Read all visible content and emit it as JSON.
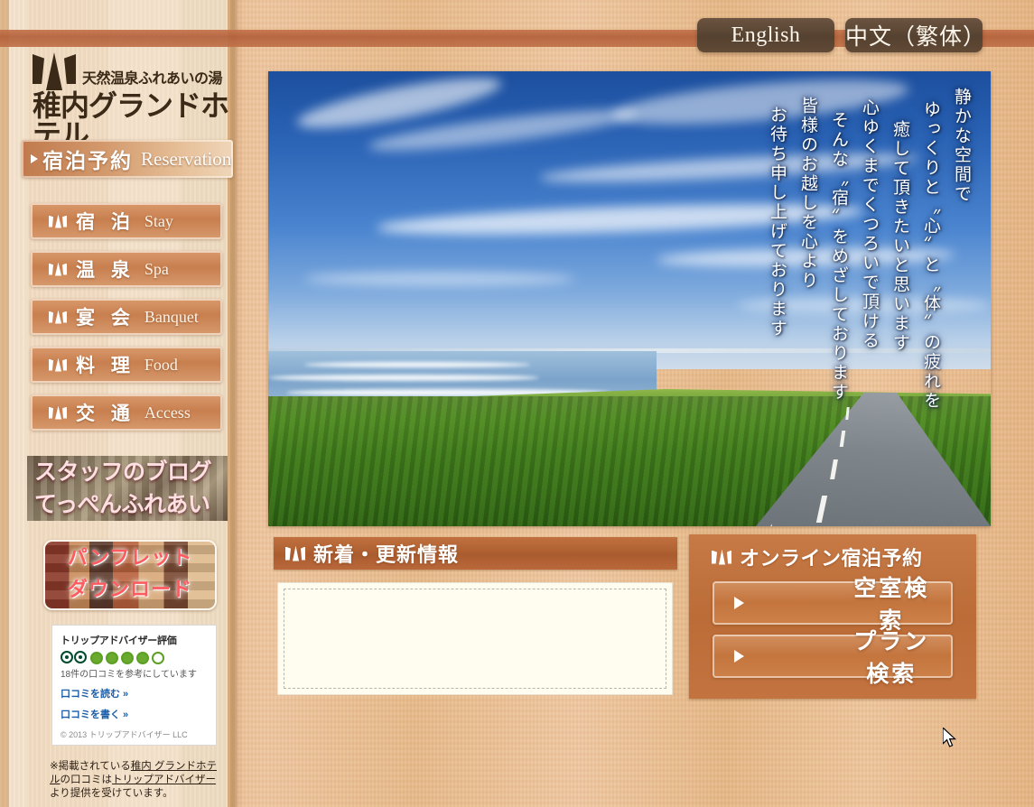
{
  "header": {
    "lang_buttons": [
      {
        "id": "english",
        "label": "English"
      },
      {
        "id": "chinese-traditional",
        "label": "中文（繁体）"
      }
    ]
  },
  "logo": {
    "mark": "mountain-logo-icon",
    "tagline": "天然温泉ふれあいの湯",
    "name": "稚内グランドホテル"
  },
  "sidebar": {
    "reservation": {
      "jp": "宿泊予約",
      "en": "Reservation"
    },
    "nav_items": [
      {
        "jp": "宿 泊",
        "en": "Stay"
      },
      {
        "jp": "温 泉",
        "en": "Spa"
      },
      {
        "jp": "宴 会",
        "en": "Banquet"
      },
      {
        "jp": "料 理",
        "en": "Food"
      },
      {
        "jp": "交 通",
        "en": "Access"
      }
    ],
    "blog": {
      "line1": "スタッフのブログ",
      "line2": "てっぺんふれあい便"
    },
    "pamphlet": {
      "line1": "パンフレット",
      "line2": "ダウンロード"
    },
    "tripadvisor": {
      "title": "トリップアドバイザー評価",
      "rating": 4,
      "rating_max": 5,
      "review_count_text": "18件の口コミを参考にしています",
      "read_link": "口コミを読む »",
      "write_link": "口コミを書く »",
      "copyright": "© 2013 トリップアドバイザー LLC",
      "note_prefix": "※掲載されている",
      "note_link1": "稚内 グランドホテル",
      "note_mid": "の口コミは",
      "note_link2": "トリップアドバイザー",
      "note_suffix": "より提供を受けています。"
    }
  },
  "hero": {
    "image_alt": "coastal-road-seascape",
    "vertical_text_columns": [
      "静かな空間で",
      "ゆっくりと〝心〟と〝体〟の疲れを",
      "癒して頂きたいと思います",
      "心ゆくまでくつろいで頂ける",
      "そんな〝宿〟をめざしております",
      "皆様のお越しを心より",
      "お待ち申し上げております"
    ]
  },
  "news": {
    "heading": "新着・更新情報",
    "body": ""
  },
  "online_reservation": {
    "heading": "オンライン宿泊予約",
    "buttons": [
      {
        "id": "room-search",
        "label": "空室検索"
      },
      {
        "id": "plan-search",
        "label": "プラン検索"
      }
    ]
  },
  "colors": {
    "accent_orange": "#bb6c37",
    "band": "#b2603a",
    "dark_brown": "#3a2a17",
    "lang_btn": "#55412f",
    "ta_green": "#6aaa2e",
    "ta_link": "#1a5ca8"
  }
}
